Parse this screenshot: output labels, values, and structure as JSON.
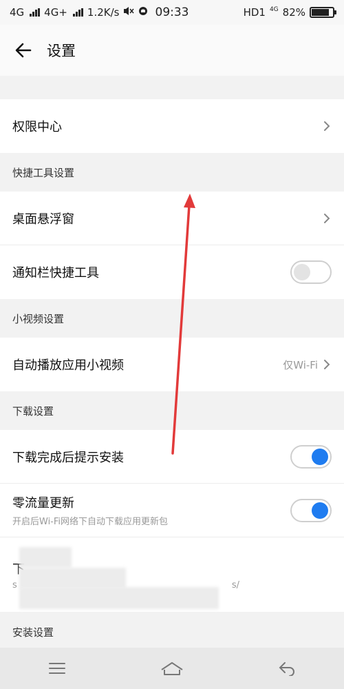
{
  "status": {
    "net1": "4G",
    "net2": "4G+",
    "speed": "1.2K/s",
    "time": "09:33",
    "hd": "HD1",
    "net3": "4G",
    "battery": "82%",
    "battery_level": 0.82
  },
  "header": {
    "title": "设置"
  },
  "rows": {
    "permission": {
      "label": "权限中心"
    },
    "quick_header": "快捷工具设置",
    "floating": {
      "label": "桌面悬浮窗"
    },
    "notif": {
      "label": "通知栏快捷工具",
      "on": false
    },
    "video_header": "小视频设置",
    "autoplay": {
      "label": "自动播放应用小视频",
      "value": "仅Wi-Fi"
    },
    "download_header": "下载设置",
    "install_prompt": {
      "label": "下载完成后提示安装",
      "on": true
    },
    "zero_traffic": {
      "label": "零流量更新",
      "sub": "开启后Wi-Fi网络下自动下载应用更新包",
      "on": true
    },
    "download_path": {
      "label": "下",
      "sub_start": "s",
      "sub_end": "s/"
    },
    "install_header": "安装设置"
  },
  "colors": {
    "accent": "#1f7cf0",
    "arrow": "#e23a3a"
  },
  "icons": {
    "back": "back-arrow-icon",
    "chevron": "chevron-right-icon",
    "menu": "menu-icon",
    "home": "home-icon",
    "back_nav": "back-nav-icon"
  }
}
